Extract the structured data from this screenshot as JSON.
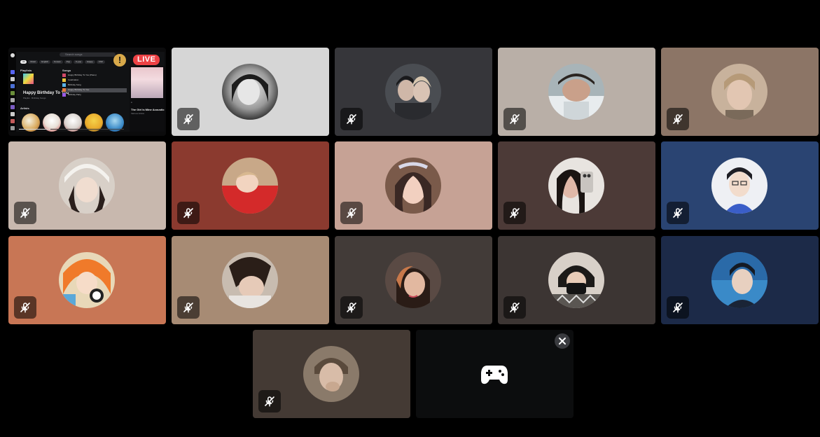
{
  "stream": {
    "live_label": "LIVE",
    "warning_glyph": "!",
    "search_placeholder": "Search songs",
    "chips": [
      "All",
      "Music",
      "English",
      "Korean",
      "Pop",
      "K-pop",
      "Happy",
      "Chill"
    ],
    "section_playlists": "Playlists",
    "section_songs": "Songs",
    "section_artists": "Artists",
    "featured_title": "Happy Birthday To You",
    "featured_subtitle": "Playlist · Birthday Songs",
    "songs": [
      "Happy Birthday To You (Piano)",
      "Celebration",
      "Birthday Song",
      "Happy Birthday To You",
      "Birthday Party"
    ],
    "now_playing_title": "The Girl Is Mine Acoustic",
    "now_playing_artist": "Various Artists",
    "colors": {
      "live": "#ed4245",
      "warning": "#d8a94a"
    }
  },
  "participants": [
    {
      "id": "p1",
      "tile_color": "#d6d6d6",
      "muted": true
    },
    {
      "id": "p2",
      "tile_color": "#36363a",
      "muted": true
    },
    {
      "id": "p3",
      "tile_color": "#b9afa7",
      "muted": true
    },
    {
      "id": "p4",
      "tile_color": "#8c7566",
      "muted": true
    },
    {
      "id": "p5",
      "tile_color": "#c8b8ae",
      "muted": true
    },
    {
      "id": "p6",
      "tile_color": "#8b3a2f",
      "muted": true
    },
    {
      "id": "p7",
      "tile_color": "#c6a295",
      "muted": true
    },
    {
      "id": "p8",
      "tile_color": "#4c3a37",
      "muted": true
    },
    {
      "id": "p9",
      "tile_color": "#2a4472",
      "muted": true
    },
    {
      "id": "p10",
      "tile_color": "#c87655",
      "muted": true
    },
    {
      "id": "p11",
      "tile_color": "#a78b74",
      "muted": true
    },
    {
      "id": "p12",
      "tile_color": "#423b38",
      "muted": true
    },
    {
      "id": "p13",
      "tile_color": "#3c3533",
      "muted": true
    },
    {
      "id": "p14",
      "tile_color": "#1c2a48",
      "muted": true
    },
    {
      "id": "p15",
      "tile_color": "#443a34",
      "muted": true
    }
  ],
  "activity_tile": {
    "icon": "gamepad-icon",
    "close_icon": "close-icon"
  },
  "icons": {
    "mute": "mic-off-icon"
  }
}
